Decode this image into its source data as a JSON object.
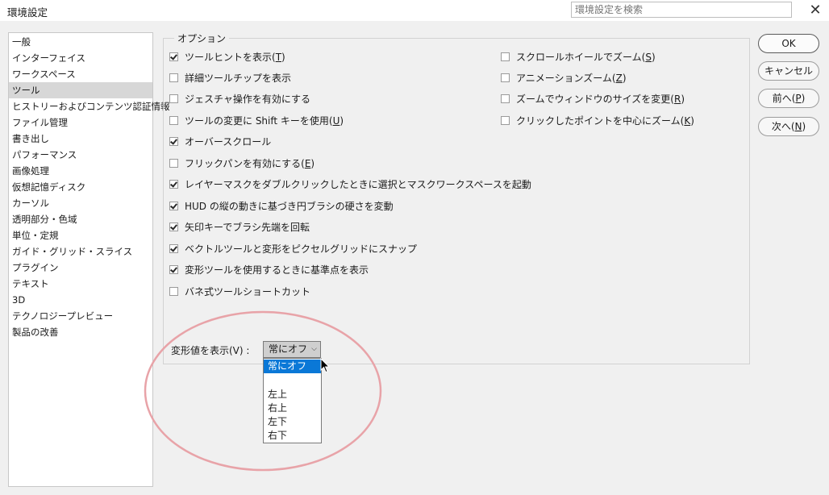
{
  "window": {
    "title": "環境設定",
    "search_placeholder": "環境設定を検索"
  },
  "sidebar": {
    "items": [
      {
        "label": "一般"
      },
      {
        "label": "インターフェイス"
      },
      {
        "label": "ワークスペース"
      },
      {
        "label": "ツール",
        "selected": true
      },
      {
        "label": "ヒストリーおよびコンテンツ認証情報"
      },
      {
        "label": "ファイル管理"
      },
      {
        "label": "書き出し"
      },
      {
        "label": "パフォーマンス"
      },
      {
        "label": "画像処理"
      },
      {
        "label": "仮想記憶ディスク"
      },
      {
        "label": "カーソル"
      },
      {
        "label": "透明部分・色域"
      },
      {
        "label": "単位・定規"
      },
      {
        "label": "ガイド・グリッド・スライス"
      },
      {
        "label": "プラグイン"
      },
      {
        "label": "テキスト"
      },
      {
        "label": "3D"
      },
      {
        "label": "テクノロジープレビュー"
      },
      {
        "label": "製品の改善"
      }
    ]
  },
  "options": {
    "legend": "オプション",
    "left": [
      {
        "label": "ツールヒントを表示(",
        "key": "T",
        "suffix": ")",
        "checked": true
      },
      {
        "label": "詳細ツールチップを表示",
        "key": "",
        "suffix": "",
        "checked": false
      },
      {
        "label": "ジェスチャ操作を有効にする",
        "key": "",
        "suffix": "",
        "checked": false
      },
      {
        "label": "ツールの変更に Shift キーを使用(",
        "key": "U",
        "suffix": ")",
        "checked": false
      },
      {
        "label": "オーバースクロール",
        "key": "",
        "suffix": "",
        "checked": true
      },
      {
        "label": "フリックパンを有効にする(",
        "key": "E",
        "suffix": ")",
        "checked": false
      },
      {
        "label": "レイヤーマスクをダブルクリックしたときに選択とマスクワークスペースを起動",
        "key": "",
        "suffix": "",
        "checked": true
      },
      {
        "label": "HUD の縦の動きに基づき円ブラシの硬さを変動",
        "key": "",
        "suffix": "",
        "checked": true
      },
      {
        "label": "矢印キーでブラシ先端を回転",
        "key": "",
        "suffix": "",
        "checked": true
      },
      {
        "label": "ベクトルツールと変形をピクセルグリッドにスナップ",
        "key": "",
        "suffix": "",
        "checked": true
      },
      {
        "label": "変形ツールを使用するときに基準点を表示",
        "key": "",
        "suffix": "",
        "checked": true
      },
      {
        "label": "バネ式ツールショートカット",
        "key": "",
        "suffix": "",
        "checked": false
      }
    ],
    "right": [
      {
        "label": "スクロールホイールでズーム(",
        "key": "S",
        "suffix": ")",
        "checked": false
      },
      {
        "label": "アニメーションズーム(",
        "key": "Z",
        "suffix": ")",
        "checked": false
      },
      {
        "label": "ズームでウィンドウのサイズを変更(",
        "key": "R",
        "suffix": ")",
        "checked": false
      },
      {
        "label": "クリックしたポイントを中心にズーム(",
        "key": "K",
        "suffix": ")",
        "checked": false
      }
    ]
  },
  "transform_values": {
    "label": "変形値を表示(V) :",
    "selected": "常にオフ",
    "options": [
      "常にオフ",
      "",
      "左上",
      "右上",
      "左下",
      "右下"
    ]
  },
  "buttons": {
    "ok": "OK",
    "cancel": "キャンセル",
    "prev_prefix": "前へ(",
    "prev_key": "P",
    "prev_suffix": ")",
    "next_prefix": "次へ(",
    "next_key": "N",
    "next_suffix": ")"
  },
  "colors": {
    "selection": "#0a78d7",
    "annotation_circle": "#e8a3a8"
  }
}
